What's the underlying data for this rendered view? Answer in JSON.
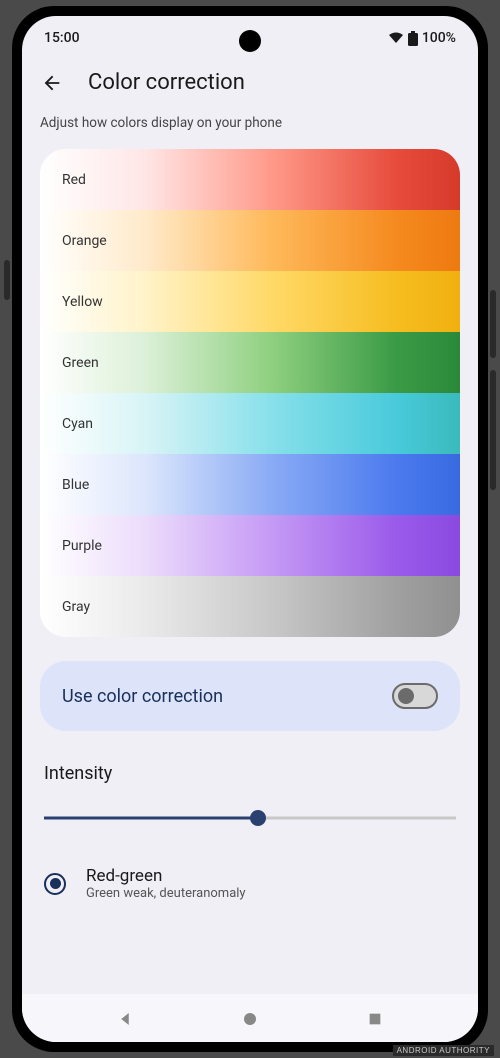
{
  "status": {
    "time": "15:00",
    "battery": "100%"
  },
  "header": {
    "title": "Color correction"
  },
  "subtitle": "Adjust how colors display on your phone",
  "colors": [
    {
      "label": "Red",
      "gradient": "linear-gradient(to right, #fff 0%, #ffe6e6 25%, #ff9a8a 55%, #e74b3b 85%, #d63a2a 100%)"
    },
    {
      "label": "Orange",
      "gradient": "linear-gradient(to right, #fff 0%, #ffeacb 25%, #ffb95a 55%, #f58a1f 85%, #ee7a10 100%)"
    },
    {
      "label": "Yellow",
      "gradient": "linear-gradient(to right, #fff 0%, #fff3c8 25%, #ffd968 55%, #f6bd20 85%, #f0b010 100%)"
    },
    {
      "label": "Green",
      "gradient": "linear-gradient(to right, #fff 0%, #dcf0d8 25%, #8fd080 55%, #3a9a45 85%, #2a8a3a 100%)"
    },
    {
      "label": "Cyan",
      "gradient": "linear-gradient(to right, #fff 0%, #d8f4f6 25%, #88e0ea 55%, #48cadb 85%, #3ababb 100%)"
    },
    {
      "label": "Blue",
      "gradient": "linear-gradient(to right, #fff 0%, #dce6fc 25%, #8aabf5 55%, #4a7aee 85%, #3a6ae0 100%)"
    },
    {
      "label": "Purple",
      "gradient": "linear-gradient(to right, #fff 0%, #ecdcfb 25%, #c59af5 55%, #9a5aea 85%, #8a4ae0 100%)"
    },
    {
      "label": "Gray",
      "gradient": "linear-gradient(to right, #fff 0%, #eaeaea 25%, #c8c8c8 55%, #a0a0a0 85%, #909090 100%)"
    }
  ],
  "toggle": {
    "label": "Use color correction",
    "enabled": false
  },
  "intensity": {
    "label": "Intensity",
    "value": 52
  },
  "option": {
    "title": "Red-green",
    "subtitle": "Green weak, deuteranomaly",
    "selected": true
  },
  "watermark": "ANDROID AUTHORITY"
}
